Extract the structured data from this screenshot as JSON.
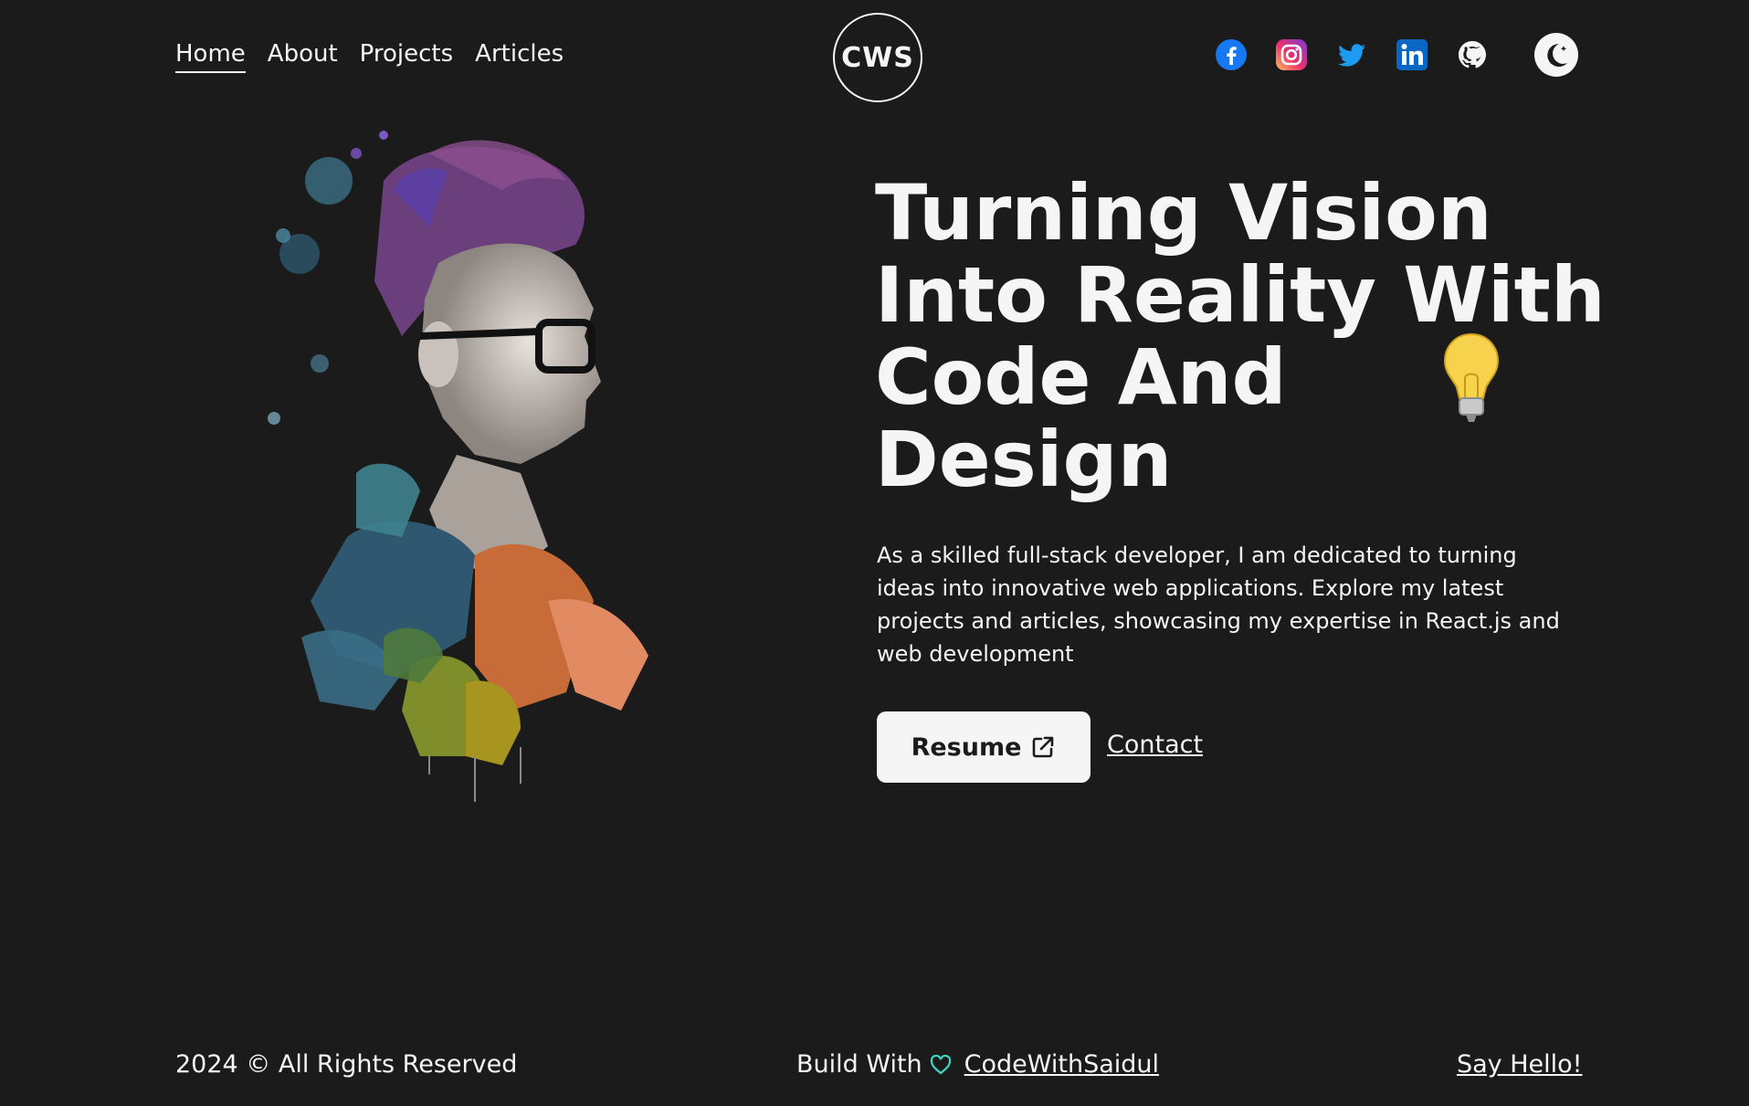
{
  "nav": {
    "items": [
      {
        "label": "Home",
        "active": true
      },
      {
        "label": "About"
      },
      {
        "label": "Projects"
      },
      {
        "label": "Articles"
      }
    ]
  },
  "logo": {
    "text": "CWS"
  },
  "socials": [
    "facebook-icon",
    "instagram-icon",
    "twitter-icon",
    "linkedin-icon",
    "github-icon"
  ],
  "theme_toggle": {
    "icon": "moon-icon"
  },
  "hero": {
    "headline": "Turning Vision Into Reality With Code And Design",
    "intro": "As a skilled full-stack developer, I am dedicated to turning ideas into innovative web applications. Explore my latest projects and articles, showcasing my expertise in React.js and web development",
    "resume_label": "Resume",
    "contact_label": "Contact"
  },
  "footer": {
    "copyright": "2024 © All Rights Reserved",
    "build_with": "Build With",
    "author": "CodeWithSaidul",
    "say_hello": "Say Hello!"
  },
  "colors": {
    "background": "#1b1b1b",
    "text": "#f5f5f5",
    "accent": "#3dd6c2"
  }
}
